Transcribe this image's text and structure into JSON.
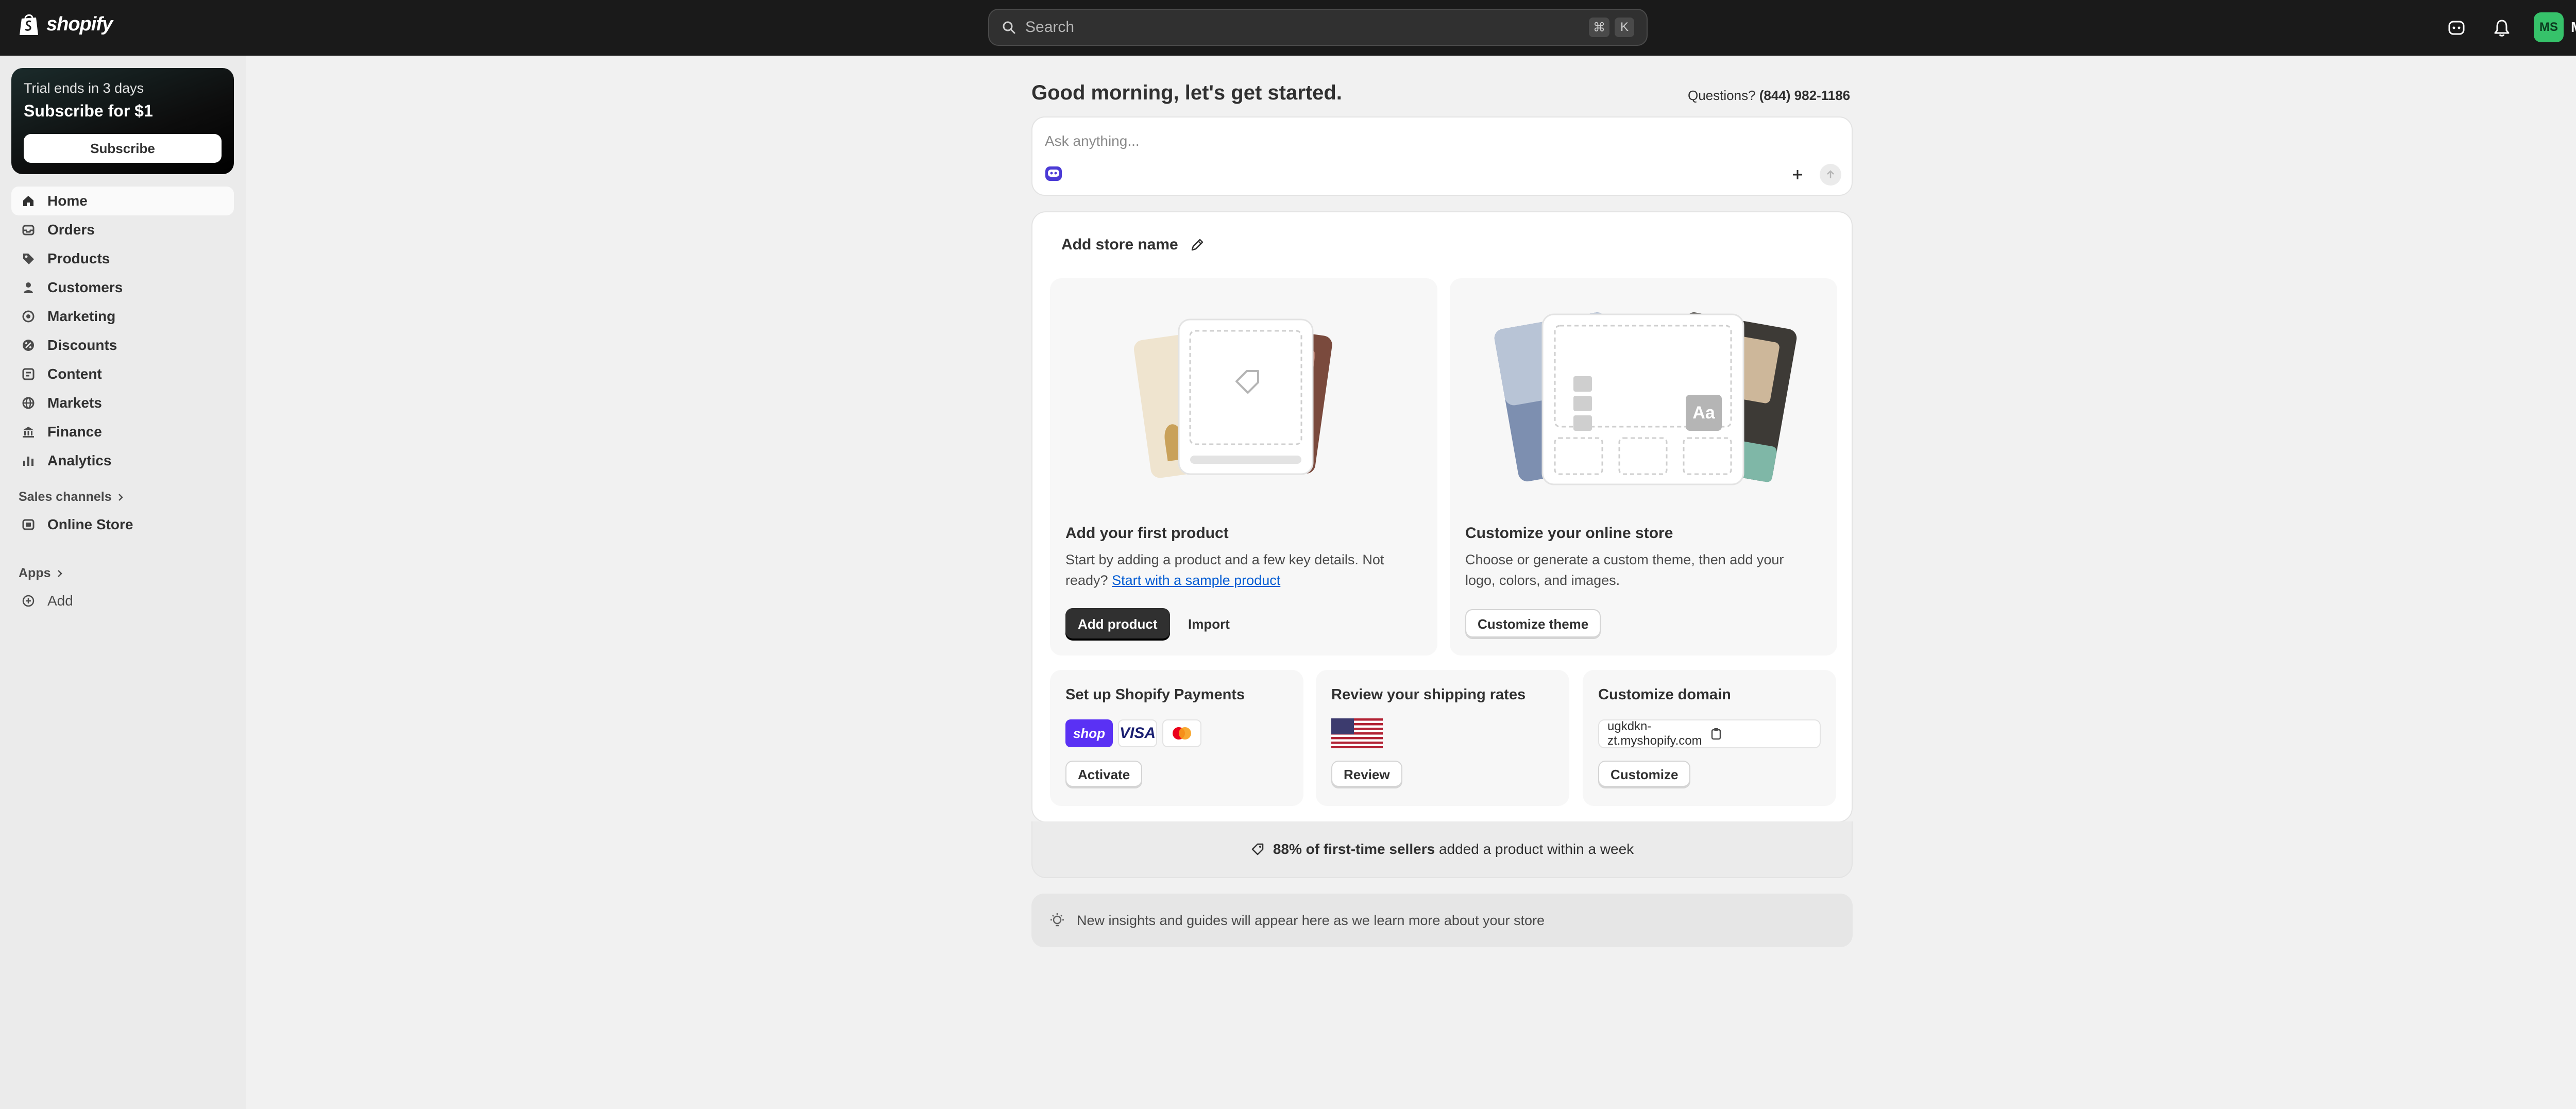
{
  "topbar": {
    "brand": "shopify",
    "search_placeholder": "Search",
    "shortcut_keys": [
      "⌘",
      "K"
    ],
    "avatar_initials": "MS",
    "store_name": "My Store"
  },
  "sidebar": {
    "trial_line1": "Trial ends in 3 days",
    "trial_line2": "Subscribe for $1",
    "subscribe_label": "Subscribe",
    "items": [
      {
        "label": "Home",
        "icon": "home-icon"
      },
      {
        "label": "Orders",
        "icon": "inbox-icon"
      },
      {
        "label": "Products",
        "icon": "tag-icon"
      },
      {
        "label": "Customers",
        "icon": "person-icon"
      },
      {
        "label": "Marketing",
        "icon": "target-icon"
      },
      {
        "label": "Discounts",
        "icon": "discount-icon"
      },
      {
        "label": "Content",
        "icon": "content-icon"
      },
      {
        "label": "Markets",
        "icon": "globe-icon"
      },
      {
        "label": "Finance",
        "icon": "bank-icon"
      },
      {
        "label": "Analytics",
        "icon": "bar-chart-icon"
      }
    ],
    "sales_channels_label": "Sales channels",
    "online_store_label": "Online Store",
    "apps_label": "Apps",
    "add_label": "Add"
  },
  "main": {
    "greeting": "Good morning, let's get started.",
    "questions_label": "Questions?",
    "phone": "(844) 982-1186",
    "ask_placeholder": "Ask anything...",
    "setup": {
      "title": "Add store name",
      "product_card": {
        "title": "Add your first product",
        "text": "Start by adding a product and a few key details. Not ready?",
        "link": "Start with a sample product",
        "primary": "Add product",
        "secondary": "Import"
      },
      "store_card": {
        "title": "Customize your online store",
        "text": "Choose or generate a custom theme, then add your logo, colors, and images.",
        "button": "Customize theme",
        "font_sample": "Aa"
      },
      "payments": {
        "title": "Set up Shopify Payments",
        "shop_label": "shop",
        "visa_label": "VISA",
        "button": "Activate"
      },
      "shipping": {
        "title": "Review your shipping rates",
        "button": "Review"
      },
      "domain": {
        "title": "Customize domain",
        "value": "ugkdkn-zt.myshopify.com",
        "button": "Customize"
      }
    },
    "tip_bold": "88% of first-time sellers",
    "tip_rest": "added a product within a week",
    "insights": "New insights and guides will appear here as we learn more about your store"
  },
  "colors": {
    "topbar": "#1a1a1a",
    "accent_green": "#36c26a",
    "link_blue": "#005bd3",
    "shop_pay": "#5a31f4"
  }
}
